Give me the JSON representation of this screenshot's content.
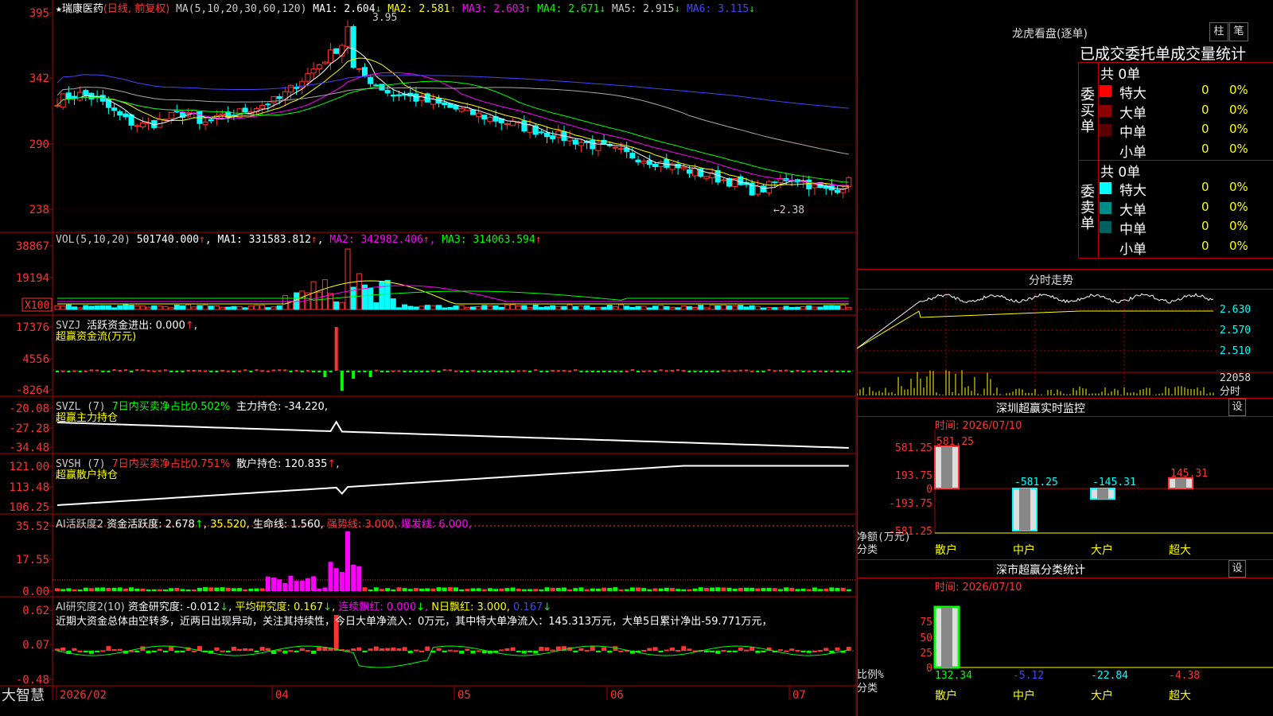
{
  "colors": {
    "up": "#ff3232",
    "down": "#00ffff",
    "grid": "#b00000",
    "text": "#cccccc",
    "yellow": "#ffff00",
    "magenta": "#ff00ff",
    "green": "#00ff00",
    "white": "#ffffff",
    "blue": "#4444ff"
  },
  "header": {
    "star": "★",
    "name": "瑞康医药",
    "period": "(日线, 前复权)",
    "ma_param": "MA(5,10,20,30,60,120)",
    "ma1": "MA1: 2.604",
    "ma1_arrow": "↓",
    "ma2": "MA2: 2.581",
    "ma2_arrow": "↑",
    "ma3": "MA3: 2.603",
    "ma3_arrow": "↑",
    "ma4": "MA4: 2.671",
    "ma4_arrow": "↓",
    "ma5": "MA5: 2.915",
    "ma5_arrow": "↓",
    "ma6": "MA6: 3.115",
    "ma6_arrow": "↓"
  },
  "price_axis": [
    "395",
    "342",
    "290",
    "238"
  ],
  "price_annot": {
    "high": "3.95",
    "low": "←2.38"
  },
  "vol": {
    "param": "VOL(5,10,20)",
    "val": "501740.000",
    "val_arrow": "↑",
    "ma1": "MA1: 331583.812",
    "ma1_arrow": "↑",
    "ma2": "MA2: 342982.406",
    "ma2_arrow": "↑",
    "ma3": "MA3: 314063.594",
    "ma3_arrow": "↑",
    "axis": [
      "38867",
      "19194"
    ],
    "unit": "X100"
  },
  "svzj": {
    "param": "SVZJ",
    "label": "活跃资金进出: 0.000",
    "arrow": "↑",
    "comma": ",",
    "sub": "超赢资金流(万元)",
    "axis": [
      "17376",
      "4556",
      "-8264"
    ]
  },
  "svzl": {
    "param": "SVZL (7)",
    "ratio": "7日内买卖净占比0.502%",
    "hold": "主力持仓: -34.220,",
    "sub": "超赢主力持仓",
    "axis": [
      "-20.08",
      "-27.28",
      "-34.48"
    ]
  },
  "svsh": {
    "param": "SVSH (7)",
    "ratio": "7日内买卖净占比0.751%",
    "hold": "散户持仓: 120.835",
    "arrow": "↑",
    "comma": ",",
    "sub": "超赢散户持仓",
    "axis": [
      "121.00",
      "113.48",
      "106.25"
    ]
  },
  "ai_act": {
    "name": "AI活跃度2",
    "act": "资金活跃度: 2.678",
    "act_arrow": "↑",
    "v2": "35.520,",
    "life": "生命线: 1.560,",
    "strong": "强势线: 3.000,",
    "burst": "爆发线: 6.000,",
    "axis": [
      "35.52",
      "17.55",
      "0.00"
    ]
  },
  "ai_res": {
    "name": "AI研究度2(10)",
    "res": "资金研究度: -0.012",
    "res_arrow": "↓",
    "avg": "平均研究度: 0.167",
    "avg_arrow": "↓",
    "streak": "连续飘红: 0.000",
    "streak_arrow": "↓",
    "nred": "N日飘红: 3.000,",
    "last": "0.167",
    "last_arrow": "↓",
    "comment": "近期大资金总体由空转多，近两日出现异动，关注其持续性，今日大单净流入：0万元，其中特大单净流入：145.313万元，大单5日累计净出-59.771万元，",
    "axis": [
      "0.62",
      "0.07",
      "-0.48"
    ]
  },
  "date_axis": [
    "2026/02",
    "04",
    "05",
    "06",
    "07"
  ],
  "brand": "大智慧",
  "right": {
    "lhb_title": "龙虎看盘(逐单)",
    "btn_column": "柱",
    "btn_pen": "笔",
    "stat_title": "已成交委托单成交量统计",
    "buy_label": [
      "委",
      "买",
      "单"
    ],
    "sell_label": [
      "委",
      "卖",
      "单"
    ],
    "buy_total": "共 0单",
    "sell_total": "共 0单",
    "buy_rows": [
      {
        "name": "特大",
        "val": "0",
        "pct": "0%",
        "color": "#ff0000"
      },
      {
        "name": "大单",
        "val": "0",
        "pct": "0%",
        "color": "#8b0000"
      },
      {
        "name": "中单",
        "val": "0",
        "pct": "0%",
        "color": "#5a0000"
      },
      {
        "name": "小单",
        "val": "0",
        "pct": "0%",
        "color": ""
      }
    ],
    "sell_rows": [
      {
        "name": "特大",
        "val": "0",
        "pct": "0%",
        "color": "#00ffff"
      },
      {
        "name": "大单",
        "val": "0",
        "pct": "0%",
        "color": "#008b8b"
      },
      {
        "name": "中单",
        "val": "0",
        "pct": "0%",
        "color": "#006060"
      },
      {
        "name": "小单",
        "val": "0",
        "pct": "0%",
        "color": ""
      }
    ],
    "intraday": {
      "title": "分时走势",
      "axis": [
        "2.630",
        "2.570",
        "2.510",
        "22058",
        "分时"
      ]
    },
    "monitor": {
      "title": "深圳超赢实时监控",
      "btn": "设",
      "time": "时间: 2026/07/10",
      "axis": [
        "581.25",
        "193.75",
        "0",
        "-193.75",
        "-581.25"
      ],
      "unit_label": "净额(万元)",
      "class_label": "分类",
      "cats": [
        "散户",
        "中户",
        "大户",
        "超大"
      ],
      "values": [
        581.25,
        -581.25,
        -145.31,
        145.31
      ],
      "value_labels": [
        "581.25",
        "-581.25",
        "-145.31",
        "145.31"
      ]
    },
    "classify": {
      "title": "深市超赢分类统计",
      "btn": "设",
      "time": "时间: 2026/07/10",
      "axis": [
        "75",
        "50",
        "25",
        "0"
      ],
      "unit_label": "比例%",
      "class_label": "分类",
      "cats": [
        "散户",
        "中户",
        "大户",
        "超大"
      ],
      "values": [
        132.34,
        -5.12,
        -22.84,
        -4.38
      ],
      "value_labels": [
        "132.34",
        "-5.12",
        "-22.84",
        "-4.38"
      ]
    }
  }
}
